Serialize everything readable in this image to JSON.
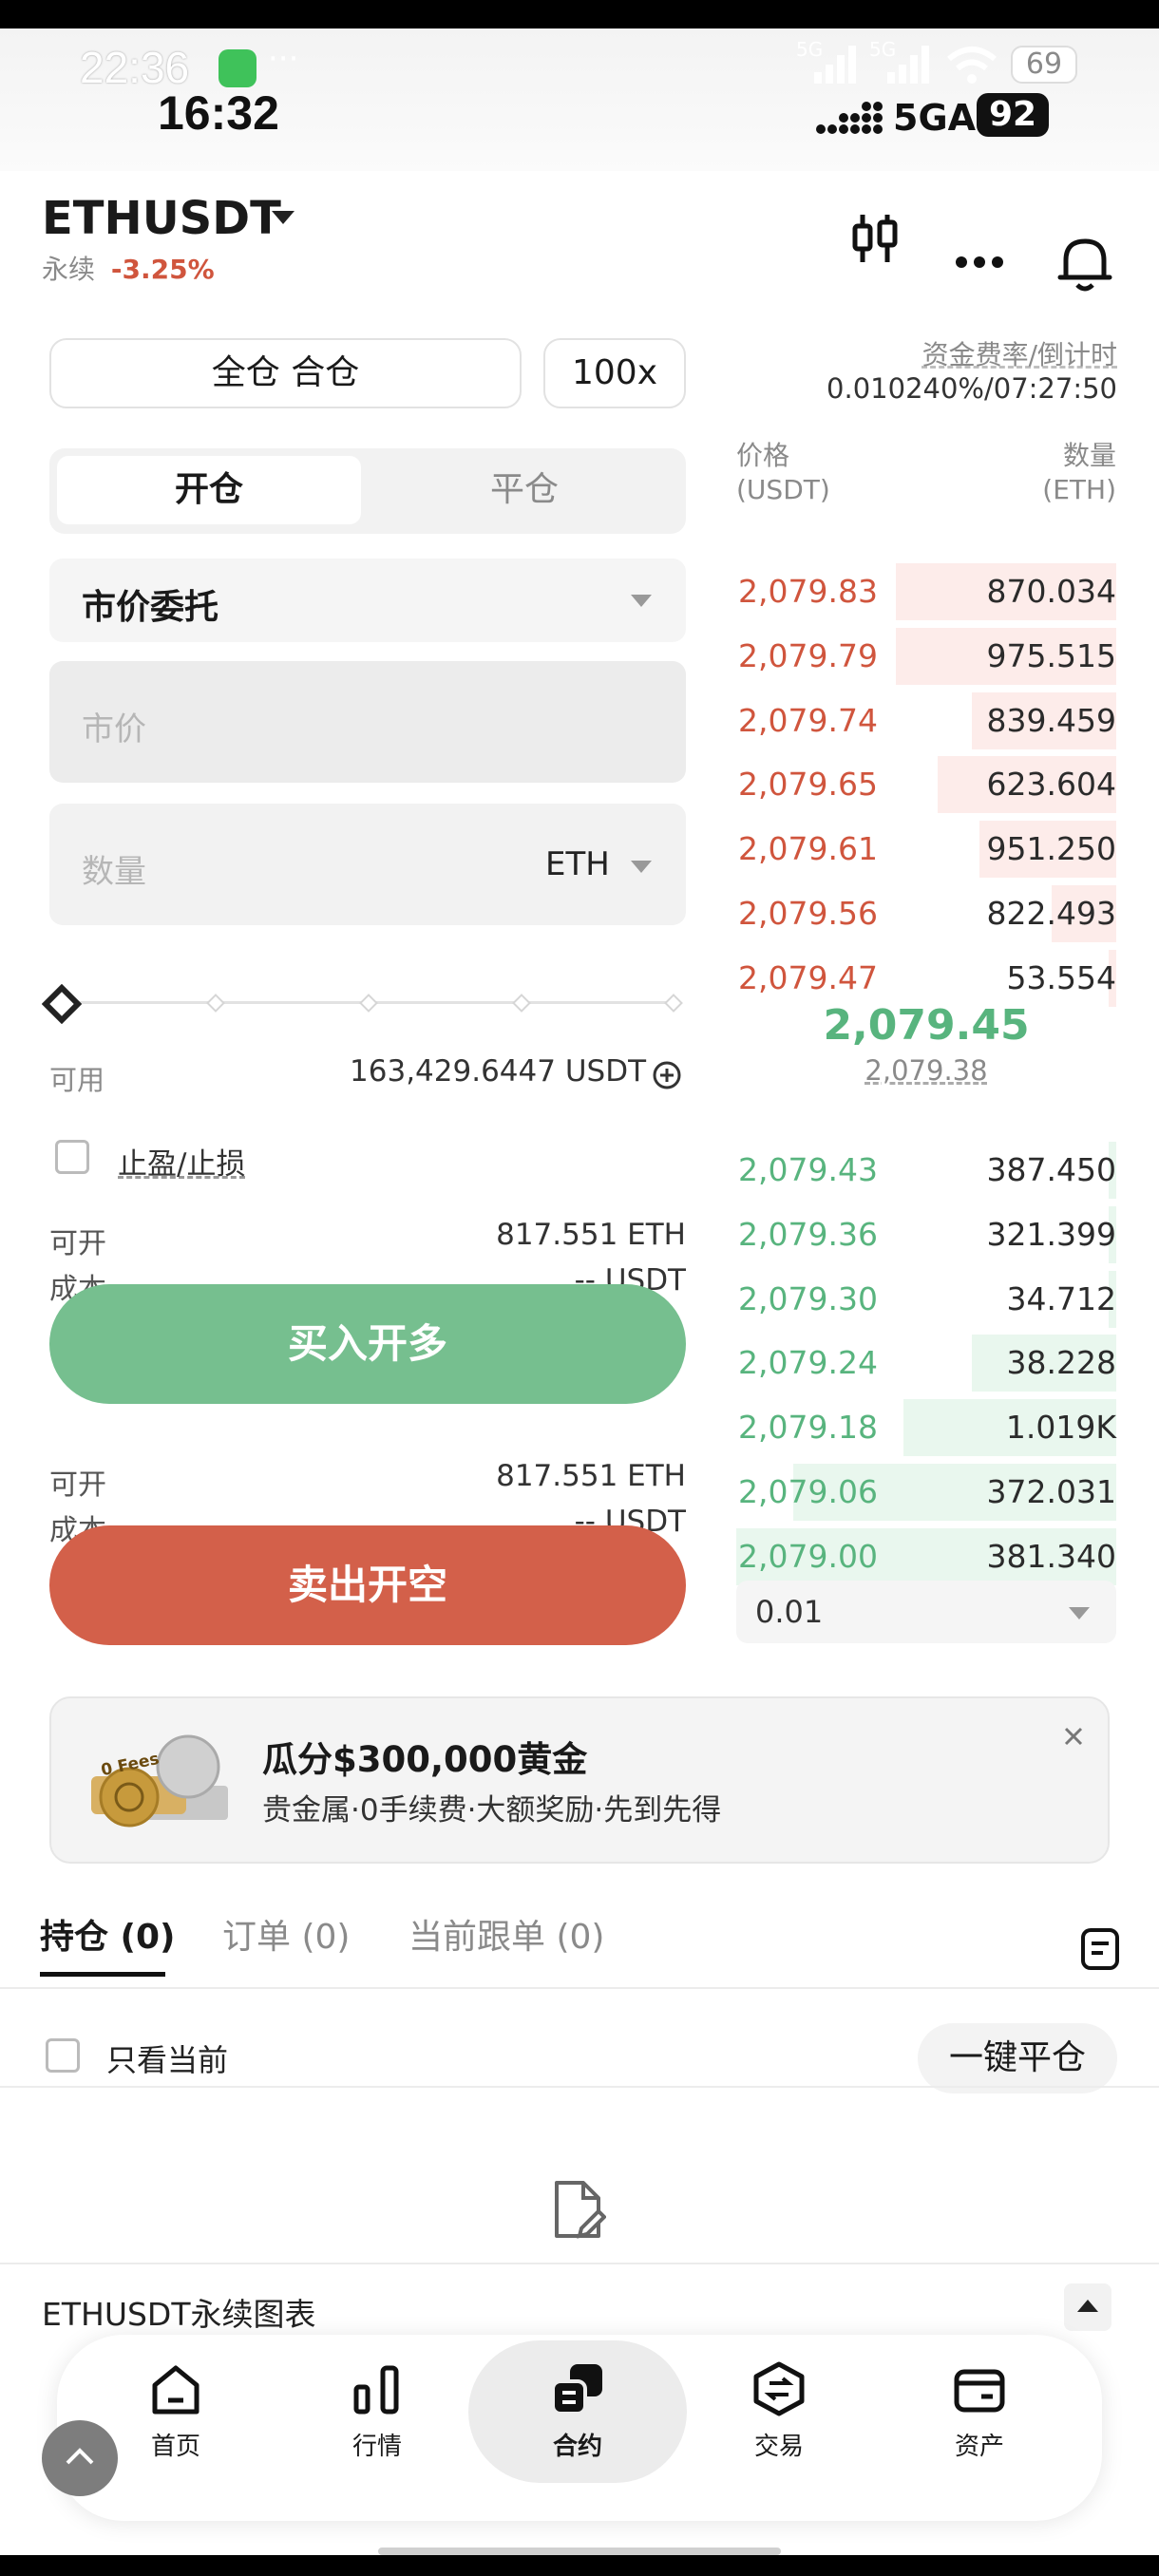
{
  "status_bar": {
    "time_main": "22:36",
    "time_secondary": "16:32",
    "dots": "···",
    "network_5g": "5G",
    "network_5ga": "5GA",
    "battery_top": "69",
    "battery_main": "92"
  },
  "header": {
    "symbol": "ETHUSDT",
    "type": "永续",
    "change": "-3.25%"
  },
  "margin": {
    "mode_label": "全仓 合仓",
    "leverage": "100x"
  },
  "funding": {
    "label": "资金费率/倒计时",
    "value": "0.010240%/07:27:50"
  },
  "trade_tabs": [
    "开仓",
    "平仓"
  ],
  "order_type": "市价委托",
  "price_field": {
    "placeholder": "市价"
  },
  "qty_field": {
    "placeholder": "数量",
    "unit": "ETH"
  },
  "slider_value_pct": 0,
  "available": {
    "label": "可用",
    "value": "163,429.6447 USDT"
  },
  "tpsl_label": "止盈/止损",
  "long_block": {
    "open_label": "可开",
    "open_value": "817.551 ETH",
    "cost_label": "成本",
    "cost_value": "-- USDT",
    "button": "买入开多"
  },
  "short_block": {
    "open_label": "可开",
    "open_value": "817.551 ETH",
    "cost_label": "成本",
    "cost_value": "-- USDT",
    "button": "卖出开空"
  },
  "orderbook": {
    "price_header": "价格",
    "price_unit": "(USDT)",
    "qty_header": "数量",
    "qty_unit": "(ETH)",
    "asks": [
      {
        "price": "2,079.83",
        "qty": "870.034",
        "depth": 0.58
      },
      {
        "price": "2,079.79",
        "qty": "975.515",
        "depth": 0.58
      },
      {
        "price": "2,079.74",
        "qty": "839.459",
        "depth": 0.38
      },
      {
        "price": "2,079.65",
        "qty": "623.604",
        "depth": 0.47
      },
      {
        "price": "2,079.61",
        "qty": "951.250",
        "depth": 0.36
      },
      {
        "price": "2,079.56",
        "qty": "822.493",
        "depth": 0.17
      },
      {
        "price": "2,079.47",
        "qty": "53.554",
        "depth": 0.02
      }
    ],
    "mid_price": "2,079.45",
    "mark_price": "2,079.38",
    "bids": [
      {
        "price": "2,079.43",
        "qty": "387.450",
        "depth": 0.02
      },
      {
        "price": "2,079.36",
        "qty": "321.399",
        "depth": 0.02
      },
      {
        "price": "2,079.30",
        "qty": "34.712",
        "depth": 0.02
      },
      {
        "price": "2,079.24",
        "qty": "38.228",
        "depth": 0.38
      },
      {
        "price": "2,079.18",
        "qty": "1.019K",
        "depth": 0.56
      },
      {
        "price": "2,079.06",
        "qty": "372.031",
        "depth": 0.85
      },
      {
        "price": "2,079.00",
        "qty": "381.340",
        "depth": 1.0
      }
    ],
    "precision": "0.01"
  },
  "promo": {
    "title": "瓜分$300,000黄金",
    "subtitle": "贵金属·0手续费·大额奖励·先到先得",
    "badge": "0 Fees"
  },
  "position_tabs": [
    "持仓 (0)",
    "订单 (0)",
    "当前跟单 (0)"
  ],
  "only_current": "只看当前",
  "close_all": "一键平仓",
  "chart_bar": "ETHUSDT永续图表",
  "nav": [
    "首页",
    "行情",
    "合约",
    "交易",
    "资产"
  ]
}
